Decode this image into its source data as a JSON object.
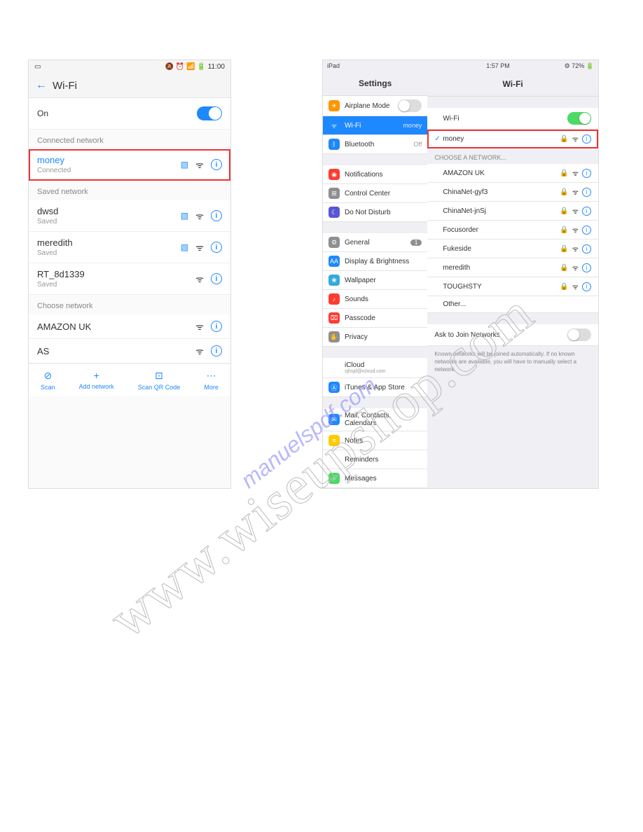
{
  "watermark_main": "www.wiseupshop.com",
  "watermark_sub": "manuelspdf.com",
  "android": {
    "status_time": "11:00",
    "status_icons": "⭯ ⏰ ⚡ 📶 🔋",
    "title": "Wi-Fi",
    "on_label": "On",
    "sections": {
      "connected": "Connected network",
      "saved": "Saved network",
      "choose": "Choose network"
    },
    "connected": {
      "name": "money",
      "status": "Connected"
    },
    "saved": [
      {
        "name": "dwsd",
        "status": "Saved",
        "qr": true
      },
      {
        "name": "meredith",
        "status": "Saved",
        "qr": true
      },
      {
        "name": "RT_8d1339",
        "status": "Saved",
        "qr": false
      }
    ],
    "choose": [
      {
        "name": "AMAZON UK"
      },
      {
        "name": "AS"
      }
    ],
    "bottom": [
      {
        "icon": "⊘",
        "label": "Scan"
      },
      {
        "icon": "+",
        "label": "Add network"
      },
      {
        "icon": "⊡",
        "label": "Scan QR Code"
      },
      {
        "icon": "⋯",
        "label": "More"
      }
    ]
  },
  "ipad": {
    "status_left": "iPad",
    "status_time": "1:57 PM",
    "status_batt": "⚙ 72% 🔋",
    "left_title": "Settings",
    "right_title": "Wi-Fi",
    "wifi_toggle_label": "Wi-Fi",
    "connected": "money",
    "choose_label": "CHOOSE A NETWORK...",
    "networks": [
      {
        "name": "AMAZON UK"
      },
      {
        "name": "ChinaNet-gyf3"
      },
      {
        "name": "ChinaNet-jnSj"
      },
      {
        "name": "Focusorder"
      },
      {
        "name": "Fukeside"
      },
      {
        "name": "meredith"
      },
      {
        "name": "TOUGHSTY"
      },
      {
        "name": "Other..."
      }
    ],
    "ask_label": "Ask to Join Networks",
    "ask_note": "Known networks will be joined automatically. If no known networks are available, you will have to manually select a network.",
    "settings": [
      {
        "icon": "✈",
        "cls": "orange",
        "label": "Airplane Mode",
        "toggle": "off"
      },
      {
        "icon": "ᯤ",
        "cls": "blue",
        "label": "Wi-Fi",
        "value": "money",
        "selected": true
      },
      {
        "icon": "ᛒ",
        "cls": "blue",
        "label": "Bluetooth",
        "value": "Off"
      },
      null,
      {
        "icon": "◉",
        "cls": "red",
        "label": "Notifications"
      },
      {
        "icon": "⊞",
        "cls": "gray",
        "label": "Control Center"
      },
      {
        "icon": "☾",
        "cls": "purple",
        "label": "Do Not Disturb"
      },
      null,
      {
        "icon": "⚙",
        "cls": "gray",
        "label": "General",
        "badge": "1"
      },
      {
        "icon": "AA",
        "cls": "blue",
        "label": "Display & Brightness"
      },
      {
        "icon": "❀",
        "cls": "teal",
        "label": "Wallpaper"
      },
      {
        "icon": "♪",
        "cls": "red",
        "label": "Sounds"
      },
      {
        "icon": "⌧",
        "cls": "red",
        "label": "Passcode"
      },
      {
        "icon": "✋",
        "cls": "gray",
        "label": "Privacy"
      },
      null,
      {
        "icon": "☁",
        "cls": "",
        "label": "iCloud",
        "sub": "sjhsjd@icloud.com"
      },
      {
        "icon": "Ⓐ",
        "cls": "blue",
        "label": "iTunes & App Store"
      },
      null,
      {
        "icon": "✉",
        "cls": "blue",
        "label": "Mail, Contacts, Calendars"
      },
      {
        "icon": "≡",
        "cls": "yellow",
        "label": "Notes"
      },
      {
        "icon": "⋮",
        "cls": "",
        "label": "Reminders"
      },
      {
        "icon": "○",
        "cls": "green",
        "label": "Messages"
      }
    ]
  }
}
